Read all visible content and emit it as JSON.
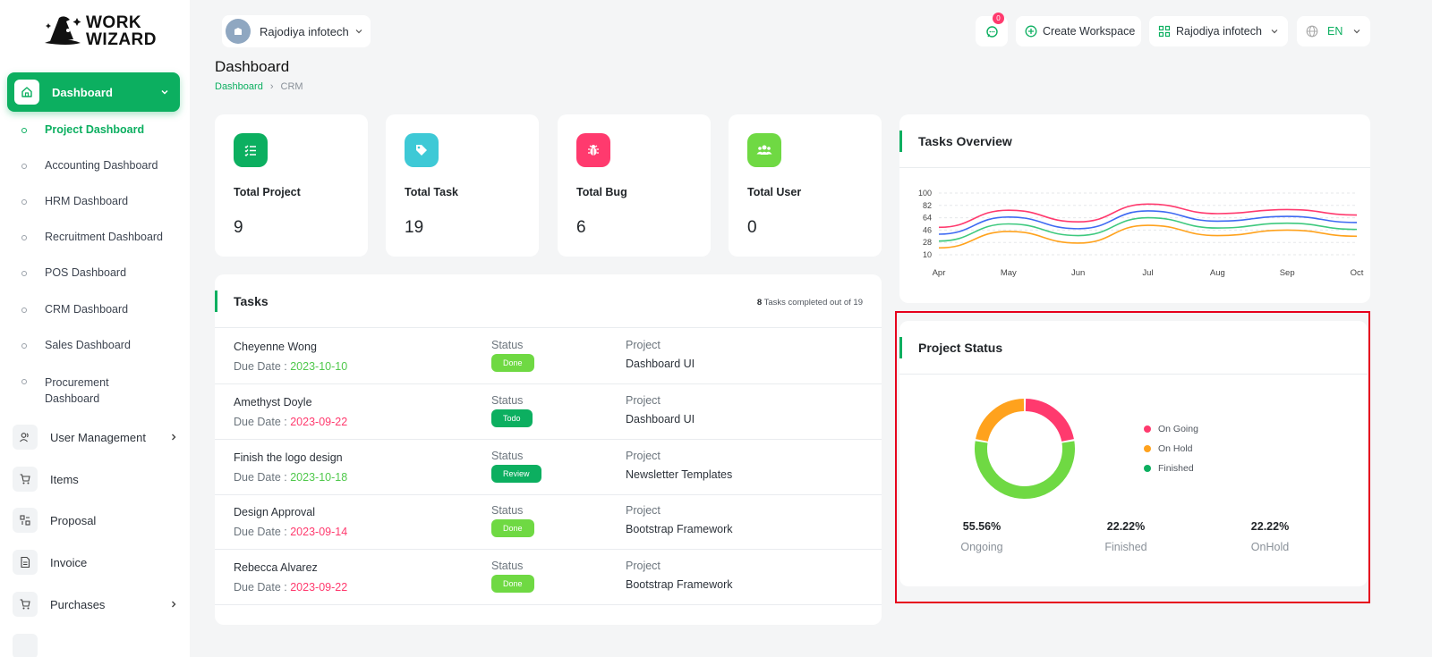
{
  "brand": {
    "line1": "WORK",
    "line2": "WIZARD"
  },
  "sidebar": {
    "active": {
      "label": "Dashboard"
    },
    "submenu": [
      {
        "label": "Project Dashboard",
        "active": true
      },
      {
        "label": "Accounting Dashboard"
      },
      {
        "label": "HRM Dashboard"
      },
      {
        "label": "Recruitment Dashboard"
      },
      {
        "label": "POS Dashboard"
      },
      {
        "label": "CRM Dashboard"
      },
      {
        "label": "Sales Dashboard"
      },
      {
        "label": "Procurement Dashboard"
      }
    ],
    "items": [
      {
        "label": "User Management",
        "icon": "users-icon",
        "has_children": true
      },
      {
        "label": "Items",
        "icon": "cart-icon"
      },
      {
        "label": "Proposal",
        "icon": "proposal-icon"
      },
      {
        "label": "Invoice",
        "icon": "invoice-icon"
      },
      {
        "label": "Purchases",
        "icon": "cart-icon",
        "has_children": true
      }
    ]
  },
  "topbar": {
    "workspace": "Rajodiya infotech",
    "chat_count": "0",
    "create_workspace": "Create Workspace",
    "company": "Rajodiya infotech",
    "language": "EN"
  },
  "page": {
    "title": "Dashboard",
    "breadcrumb": [
      "Dashboard",
      "CRM"
    ]
  },
  "stats": [
    {
      "label": "Total Project",
      "value": "9",
      "color": "#0caf60",
      "icon": "checklist-icon"
    },
    {
      "label": "Total Task",
      "value": "19",
      "color": "#3ec9d6",
      "icon": "tag-icon"
    },
    {
      "label": "Total Bug",
      "value": "6",
      "color": "#ff3a6e",
      "icon": "bug-icon"
    },
    {
      "label": "Total User",
      "value": "0",
      "color": "#6fd943",
      "icon": "users-icon"
    }
  ],
  "tasks": {
    "title": "Tasks",
    "completed": "8",
    "summary_text": "Tasks completed out of 19",
    "status_label": "Status",
    "project_label": "Project",
    "due_label": "Due Date : ",
    "rows": [
      {
        "name": "Cheyenne Wong",
        "due": "2023-10-10",
        "due_color": "green",
        "status": "Done",
        "status_color": "#6fd943",
        "project": "Dashboard UI"
      },
      {
        "name": "Amethyst Doyle",
        "due": "2023-09-22",
        "due_color": "red",
        "status": "Todo",
        "status_color": "#0caf60",
        "project": "Dashboard UI"
      },
      {
        "name": "Finish the logo design",
        "due": "2023-10-18",
        "due_color": "green",
        "status": "Review",
        "status_color": "#0caf60",
        "project": "Newsletter Templates"
      },
      {
        "name": "Design Approval",
        "due": "2023-09-14",
        "due_color": "red",
        "status": "Done",
        "status_color": "#6fd943",
        "project": "Bootstrap Framework"
      },
      {
        "name": "Rebecca Alvarez",
        "due": "2023-09-22",
        "due_color": "red",
        "status": "Done",
        "status_color": "#6fd943",
        "project": "Bootstrap Framework"
      }
    ]
  },
  "overview": {
    "title": "Tasks Overview"
  },
  "project_status": {
    "title": "Project Status",
    "legend": [
      {
        "label": "On Going",
        "color": "#ff3a6e"
      },
      {
        "label": "On Hold",
        "color": "#ffa21d"
      },
      {
        "label": "Finished",
        "color": "#0caf60"
      }
    ],
    "stats": [
      {
        "pct": "55.56%",
        "name": "Ongoing"
      },
      {
        "pct": "22.22%",
        "name": "Finished"
      },
      {
        "pct": "22.22%",
        "name": "OnHold"
      }
    ]
  },
  "chart_data": [
    {
      "type": "line",
      "title": "Tasks Overview",
      "x": [
        "Apr",
        "May",
        "Jun",
        "Jul",
        "Aug",
        "Sep",
        "Oct"
      ],
      "yticks": [
        10,
        28,
        46,
        64,
        82,
        100
      ],
      "ylim": [
        10,
        100
      ],
      "grid": true,
      "series": [
        {
          "color": "#ff3a6e",
          "values": [
            50,
            75,
            58,
            84,
            70,
            76,
            68
          ]
        },
        {
          "color": "#3e6af2",
          "values": [
            40,
            65,
            48,
            74,
            59,
            66,
            57
          ]
        },
        {
          "color": "#3ec97e",
          "values": [
            30,
            55,
            38,
            64,
            49,
            56,
            47
          ]
        },
        {
          "color": "#ffa21d",
          "values": [
            20,
            44,
            27,
            53,
            38,
            46,
            37
          ]
        }
      ]
    },
    {
      "type": "pie",
      "title": "Project Status",
      "categories": [
        "On Going",
        "On Hold",
        "Finished"
      ],
      "values": [
        22.22,
        22.22,
        55.56
      ],
      "colors": [
        "#ff3a6e",
        "#ffa21d",
        "#6fd943"
      ]
    }
  ]
}
